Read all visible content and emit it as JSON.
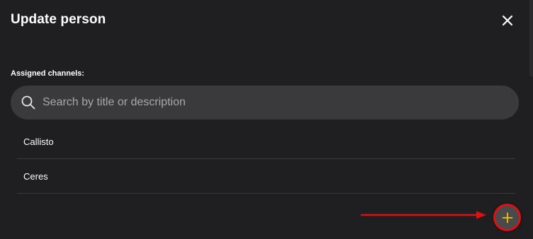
{
  "dialog": {
    "title": "Update person",
    "close_icon": "close-icon"
  },
  "channels": {
    "label": "Assigned channels:",
    "search": {
      "placeholder": "Search by title or description",
      "value": "",
      "icon": "search-icon"
    },
    "items": [
      {
        "label": "Callisto"
      },
      {
        "label": "Ceres"
      }
    ]
  },
  "add_button": {
    "icon": "plus-icon",
    "icon_color": "#f2c200"
  },
  "annotation": {
    "color": "#e01010"
  }
}
